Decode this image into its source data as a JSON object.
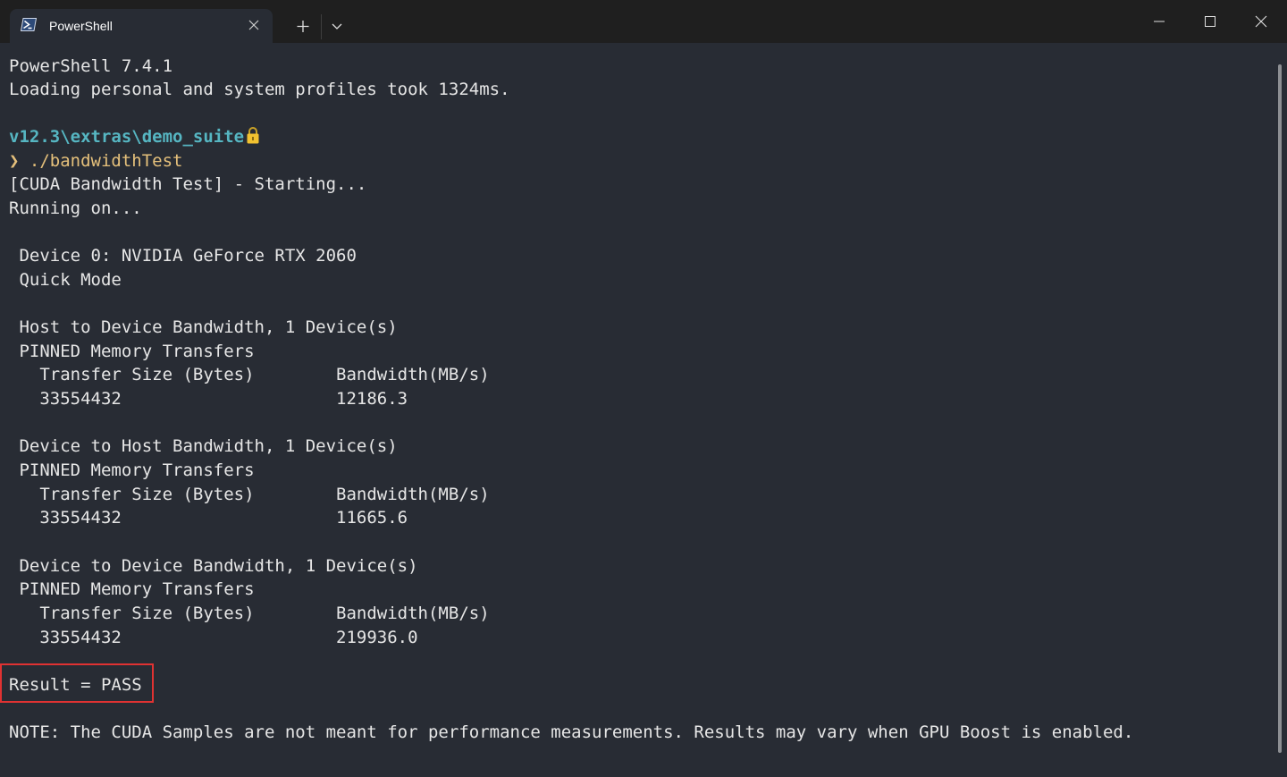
{
  "tab": {
    "title": "PowerShell",
    "icon": "powershell-icon"
  },
  "colors": {
    "background": "#282c34",
    "titlebar": "#1f1f1f",
    "text": "#e6e6e6",
    "path": "#56b6c2",
    "prompt": "#e5c07b",
    "highlight_box": "#e03232"
  },
  "terminal": {
    "banner_version": "PowerShell 7.4.1",
    "banner_profiles": "Loading personal and system profiles took 1324ms.",
    "prompt_path": "v12.3\\extras\\demo_suite",
    "prompt_arrow": "❯",
    "command": "./bandwidthTest",
    "starting": "[CUDA Bandwidth Test] - Starting...",
    "running_on": "Running on...",
    "device": " Device 0: NVIDIA GeForce RTX 2060",
    "mode": " Quick Mode",
    "sections": [
      {
        "title": " Host to Device Bandwidth, 1 Device(s)",
        "memory": " PINNED Memory Transfers",
        "header": "   Transfer Size (Bytes)        Bandwidth(MB/s)",
        "row": "   33554432                     12186.3"
      },
      {
        "title": " Device to Host Bandwidth, 1 Device(s)",
        "memory": " PINNED Memory Transfers",
        "header": "   Transfer Size (Bytes)        Bandwidth(MB/s)",
        "row": "   33554432                     11665.6"
      },
      {
        "title": " Device to Device Bandwidth, 1 Device(s)",
        "memory": " PINNED Memory Transfers",
        "header": "   Transfer Size (Bytes)        Bandwidth(MB/s)",
        "row": "   33554432                     219936.0"
      }
    ],
    "result": "Result = PASS",
    "note": "NOTE: The CUDA Samples are not meant for performance measurements. Results may vary when GPU Boost is enabled."
  }
}
